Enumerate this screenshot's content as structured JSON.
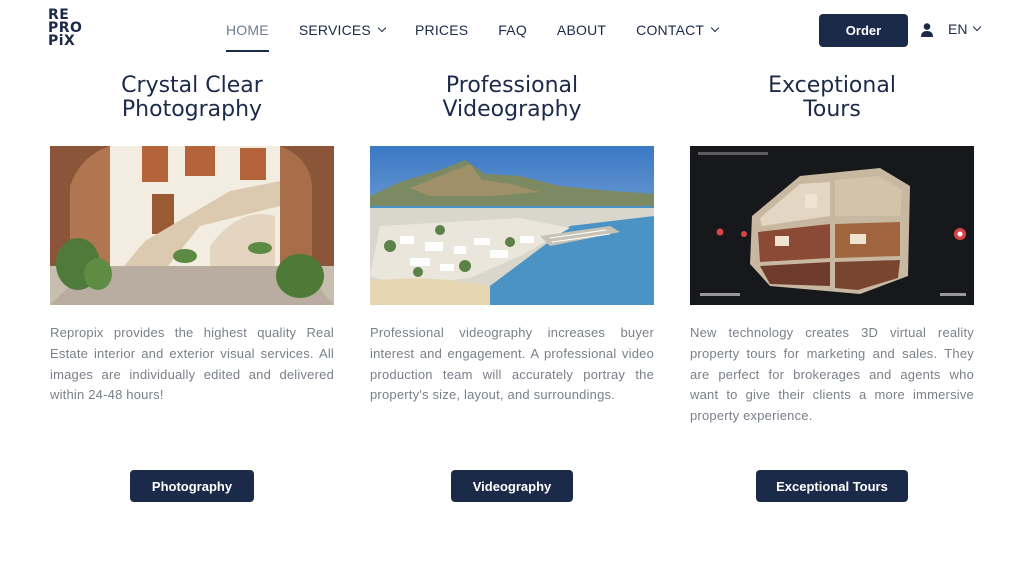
{
  "logo": {
    "lines": [
      "RE",
      "PRO",
      "PiX"
    ]
  },
  "nav": {
    "items": [
      {
        "label": "HOME",
        "active": true,
        "dropdown": false
      },
      {
        "label": "SERVICES",
        "active": false,
        "dropdown": true
      },
      {
        "label": "PRICES",
        "active": false,
        "dropdown": false
      },
      {
        "label": "FAQ",
        "active": false,
        "dropdown": false
      },
      {
        "label": "ABOUT",
        "active": false,
        "dropdown": false
      },
      {
        "label": "CONTACT",
        "active": false,
        "dropdown": true
      }
    ],
    "order_label": "Order",
    "language": "EN"
  },
  "columns": [
    {
      "title_lines": [
        "Crystal Clear",
        "Photography"
      ],
      "description": "Repropix provides the highest quality Real Estate interior and exterior visual services. All images are individually edited and delivered within 24-48 hours!",
      "button": "Photography"
    },
    {
      "title_lines": [
        "Professional",
        "Videography"
      ],
      "description": "Professional videography increases buyer interest and engagement. A professional video production team will accurately portray the property's size, layout, and surroundings.",
      "button": "Videography"
    },
    {
      "title_lines": [
        "Exceptional",
        "Tours"
      ],
      "description": "New technology creates 3D virtual reality property tours for marketing and sales. They are perfect for brokerages and agents who want to give their clients a more immersive property experience.",
      "button": "Exceptional Tours"
    }
  ],
  "colors": {
    "navy": "#1c2a4a",
    "text_gray": "#7a7f89"
  }
}
